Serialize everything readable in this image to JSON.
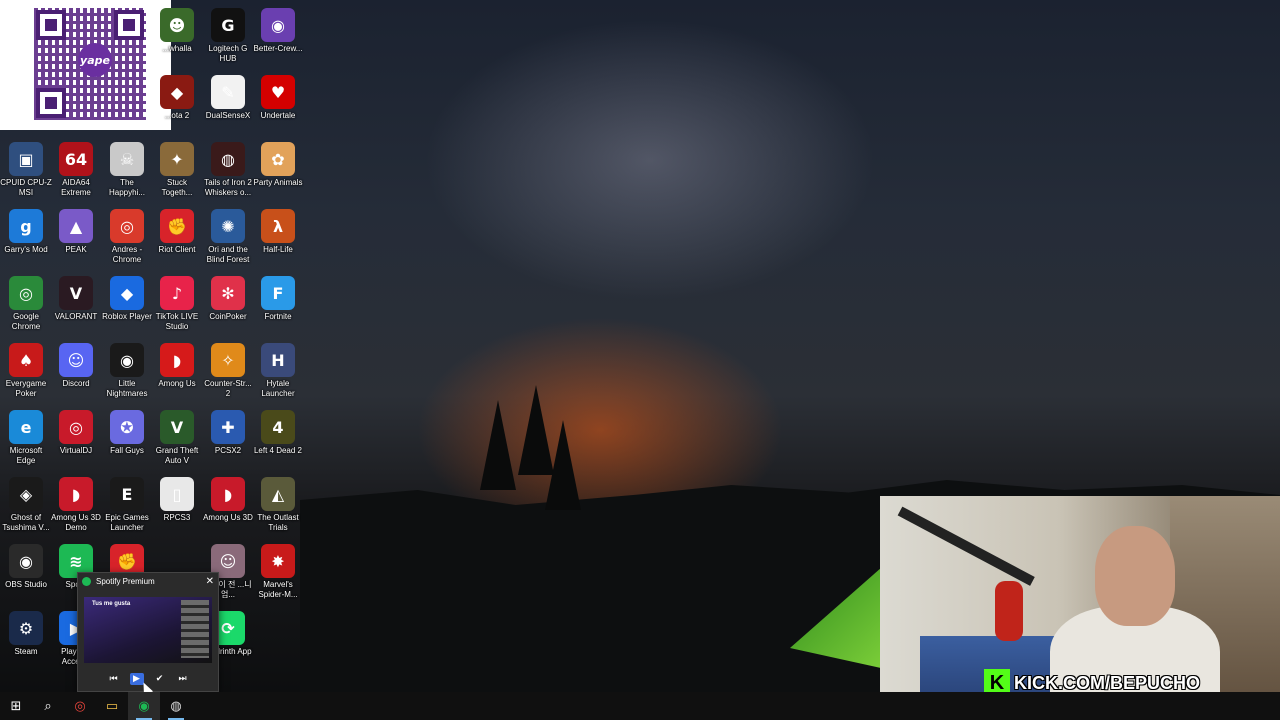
{
  "desktop": {
    "icons": [
      {
        "label": "...whalla",
        "glyph": "☻",
        "color": "#3a6a2a"
      },
      {
        "label": "Logitech G HUB",
        "glyph": "G",
        "color": "#111111"
      },
      {
        "label": "Better-Crew...",
        "glyph": "◉",
        "color": "#6a3fb0"
      },
      {
        "label": "...ota 2",
        "glyph": "◆",
        "color": "#8a1a12"
      },
      {
        "label": "DualSenseX",
        "glyph": "✎",
        "color": "#f2f2f2"
      },
      {
        "label": "Undertale",
        "glyph": "♥",
        "color": "#d40000"
      },
      {
        "label": "CPUID CPU-Z MSI",
        "glyph": "▣",
        "color": "#2f4f7f"
      },
      {
        "label": "AIDA64 Extreme",
        "glyph": "64",
        "color": "#b0121a"
      },
      {
        "label": "The Happyhi...",
        "glyph": "☠",
        "color": "#c9c9c9"
      },
      {
        "label": "Stuck Togeth...",
        "glyph": "✦",
        "color": "#8a6a3a"
      },
      {
        "label": "Tails of Iron 2 Whiskers o...",
        "glyph": "◍",
        "color": "#3a1a1a"
      },
      {
        "label": "Party Animals",
        "glyph": "✿",
        "color": "#e2a25a"
      },
      {
        "label": "Garry's Mod",
        "glyph": "g",
        "color": "#1d7ad8"
      },
      {
        "label": "PEAK",
        "glyph": "▲",
        "color": "#7a5ac8"
      },
      {
        "label": "Andres - Chrome",
        "glyph": "◎",
        "color": "#d93a2b"
      },
      {
        "label": "Riot Client",
        "glyph": "✊",
        "color": "#d8232a"
      },
      {
        "label": "Ori and the Blind Forest",
        "glyph": "✺",
        "color": "#2a5a9a"
      },
      {
        "label": "Half-Life",
        "glyph": "λ",
        "color": "#c8501a"
      },
      {
        "label": "Google Chrome",
        "glyph": "◎",
        "color": "#2a8a3a"
      },
      {
        "label": "VALORANT",
        "glyph": "V",
        "color": "#2a1a22"
      },
      {
        "label": "Roblox Player",
        "glyph": "◆",
        "color": "#1a6ae0"
      },
      {
        "label": "TikTok LIVE Studio",
        "glyph": "♪",
        "color": "#e8234a"
      },
      {
        "label": "CoinPoker",
        "glyph": "✻",
        "color": "#e0314a"
      },
      {
        "label": "Fortnite",
        "glyph": "F",
        "color": "#2a9ae8"
      },
      {
        "label": "Everygame Poker",
        "glyph": "♠",
        "color": "#c81a1a"
      },
      {
        "label": "Discord",
        "glyph": "☺",
        "color": "#5865f2"
      },
      {
        "label": "Little Nightmares",
        "glyph": "◉",
        "color": "#1a1a1a"
      },
      {
        "label": "Among Us",
        "glyph": "◗",
        "color": "#d61a1a"
      },
      {
        "label": "Counter-Str... 2",
        "glyph": "✧",
        "color": "#e08a1a"
      },
      {
        "label": "Hytale Launcher",
        "glyph": "H",
        "color": "#3a4a7a"
      },
      {
        "label": "Microsoft Edge",
        "glyph": "e",
        "color": "#1a8ad8"
      },
      {
        "label": "VirtualDJ",
        "glyph": "◎",
        "color": "#c81a2a"
      },
      {
        "label": "Fall Guys",
        "glyph": "✪",
        "color": "#6a6ae0"
      },
      {
        "label": "Grand Theft Auto V",
        "glyph": "V",
        "color": "#2a5a2a"
      },
      {
        "label": "PCSX2",
        "glyph": "✚",
        "color": "#2a5ab0"
      },
      {
        "label": "Left 4 Dead 2",
        "glyph": "4",
        "color": "#4a4a1a"
      },
      {
        "label": "Ghost of Tsushima V...",
        "glyph": "◈",
        "color": "#1a1a1a"
      },
      {
        "label": "Among Us 3D Demo",
        "glyph": "◗",
        "color": "#c81a2a"
      },
      {
        "label": "Epic Games Launcher",
        "glyph": "E",
        "color": "#1a1a1a"
      },
      {
        "label": "RPCS3",
        "glyph": "▯",
        "color": "#e8e8e8"
      },
      {
        "label": "Among Us 3D",
        "glyph": "◗",
        "color": "#c81a2a"
      },
      {
        "label": "The Outlast Trials",
        "glyph": "◭",
        "color": "#5a5a3a"
      },
      {
        "label": "OBS Studio",
        "glyph": "◉",
        "color": "#2a2a2a"
      },
      {
        "label": "Spo...",
        "glyph": "≋",
        "color": "#1db954"
      },
      {
        "label": "",
        "glyph": "✊",
        "color": "#d8232a"
      },
      {
        "label": "...생이 전 ...니엄...",
        "glyph": "☺",
        "color": "#8a6a7a"
      },
      {
        "label": "Marvel's Spider-M...",
        "glyph": "✸",
        "color": "#c81a1a"
      },
      {
        "label": "Steam",
        "glyph": "⚙",
        "color": "#1a2a4a"
      },
      {
        "label": "PlaySt... Acces...",
        "glyph": "▶",
        "color": "#1a6ae0"
      },
      {
        "label": "...odrinth App",
        "glyph": "⟳",
        "color": "#1bd96a"
      }
    ]
  },
  "qr": {
    "logo_text": "yape"
  },
  "spotify_popup": {
    "title": "Spotify Premium",
    "close_glyph": "✕",
    "preview_banner": "Tus me gusta",
    "prev_glyph": "⏮",
    "play_glyph": "▶",
    "like_glyph": "✔",
    "next_glyph": "⏭"
  },
  "overlay": {
    "kick_logo": "K",
    "kick_text": "KICK.COM/BEPUCHO"
  },
  "taskbar": {
    "start_glyph": "⊞",
    "search_glyph": "⌕",
    "chrome_glyph": "◎",
    "explorer_glyph": "▭",
    "spotify_glyph": "◉",
    "obs_glyph": "◍"
  }
}
